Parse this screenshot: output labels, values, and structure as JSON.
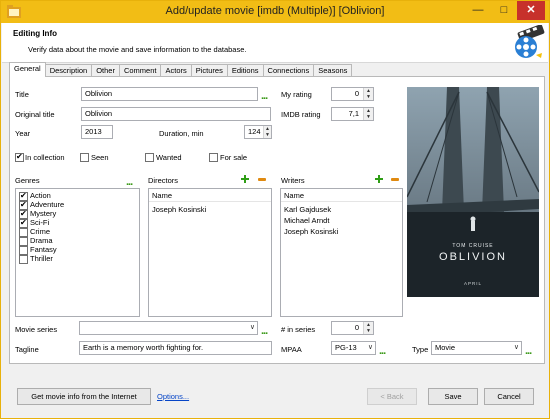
{
  "window": {
    "title": "Add/update movie [imdb (Multiple)] [Oblivion]",
    "minimize": "—",
    "maximize": "□",
    "close": "✕"
  },
  "header": {
    "title": "Editing Info",
    "subtitle": "Verify data about the movie and save information to the database."
  },
  "tabs": [
    "General",
    "Description",
    "Other",
    "Comment",
    "Actors",
    "Pictures",
    "Editions",
    "Connections",
    "Seasons"
  ],
  "general": {
    "title_label": "Title",
    "title_value": "Oblivion",
    "original_title_label": "Original title",
    "original_title_value": "Oblivion",
    "year_label": "Year",
    "year_value": "2013",
    "duration_label": "Duration, min",
    "duration_value": "124",
    "my_rating_label": "My rating",
    "my_rating_value": "0",
    "imdb_rating_label": "IMDB rating",
    "imdb_rating_value": "7,1",
    "checkboxes": [
      {
        "label": "In collection",
        "checked": true
      },
      {
        "label": "Seen",
        "checked": false
      },
      {
        "label": "Wanted",
        "checked": false
      },
      {
        "label": "For sale",
        "checked": false
      }
    ],
    "genres_label": "Genres",
    "genres": [
      {
        "label": "Action",
        "checked": true
      },
      {
        "label": "Adventure",
        "checked": true
      },
      {
        "label": "Mystery",
        "checked": true
      },
      {
        "label": "Sci-Fi",
        "checked": true
      },
      {
        "label": "Crime",
        "checked": false
      },
      {
        "label": "Drama",
        "checked": false
      },
      {
        "label": "Fantasy",
        "checked": false
      },
      {
        "label": "Thriller",
        "checked": false
      }
    ],
    "directors_label": "Directors",
    "directors_header": "Name",
    "directors": [
      "Joseph Kosinski"
    ],
    "writers_label": "Writers",
    "writers_header": "Name",
    "writers": [
      "Karl Gajdusek",
      "Michael Arndt",
      "Joseph Kosinski"
    ],
    "movie_series_label": "Movie series",
    "movie_series_value": "",
    "num_in_series_label": "# in series",
    "num_in_series_value": "0",
    "tagline_label": "Tagline",
    "tagline_value": "Earth is a memory worth fighting for.",
    "mpaa_label": "MPAA",
    "mpaa_value": "PG-13",
    "type_label": "Type",
    "type_value": "Movie"
  },
  "poster": {
    "actor": "TOM CRUISE",
    "title": "OBLIVION",
    "date": "APRIL"
  },
  "footer": {
    "get_info_label": "Get movie info from the Internet",
    "options_label": "Options...",
    "back_label": "< Back",
    "save_label": "Save",
    "cancel_label": "Cancel"
  },
  "colors": {
    "title_bar": "#f2bd15",
    "close_button": "#c7312b",
    "add_icon": "#2f9e16",
    "remove_icon": "#e08a10",
    "link": "#0645c7"
  }
}
